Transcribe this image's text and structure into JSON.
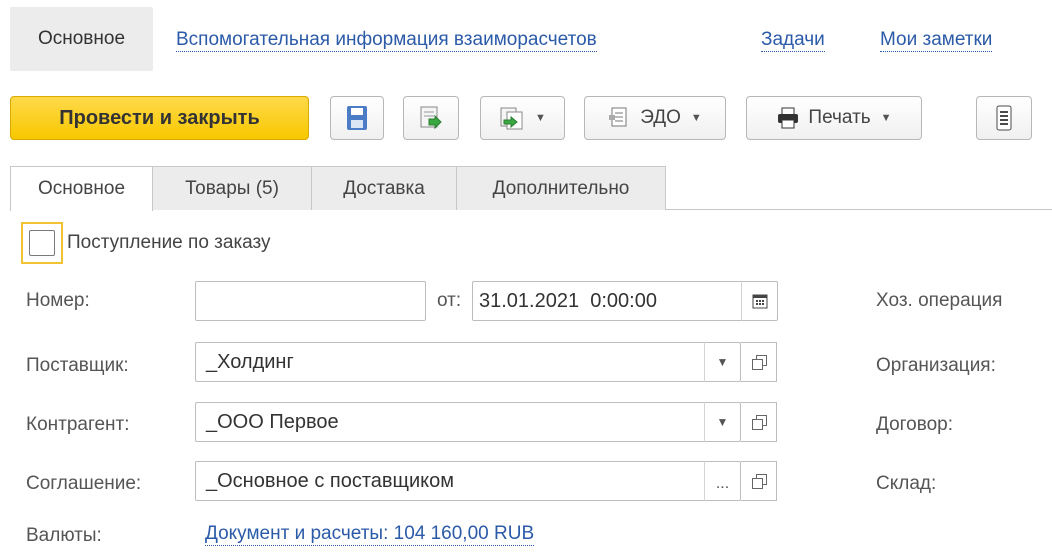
{
  "nav": {
    "main": "Основное",
    "aux_info": "Вспомогательная информация взаиморасчетов",
    "tasks": "Задачи",
    "notes": "Мои заметки"
  },
  "toolbar": {
    "post_close": "Провести и закрыть",
    "edo": "ЭДО",
    "print": "Печать"
  },
  "tabs": [
    {
      "label": "Основное",
      "active": true
    },
    {
      "label": "Товары (5)",
      "active": false
    },
    {
      "label": "Доставка",
      "active": false
    },
    {
      "label": "Дополнительно",
      "active": false
    }
  ],
  "form": {
    "by_order_label": "Поступление по заказу",
    "by_order_checked": false,
    "number_label": "Номер:",
    "number_value": "",
    "date_from_label": "от:",
    "date_value": "31.01.2021  0:00:00",
    "supplier_label": "Поставщик:",
    "supplier_value": "_Холдинг",
    "counterparty_label": "Контрагент:",
    "counterparty_value": "_ООО Первое",
    "agreement_label": "Соглашение:",
    "agreement_value": "_Основное с поставщиком",
    "agreement_select": "...",
    "currencies_label": "Валюты:",
    "currencies_link": "Документ и расчеты: 104 160,00 RUB",
    "right_labels": {
      "operation": "Хоз. операция",
      "organization": "Организация:",
      "contract": "Договор:",
      "warehouse": "Склад:"
    }
  },
  "colors": {
    "accent_yellow": "#f7c800",
    "link_blue": "#2b5aa8"
  }
}
